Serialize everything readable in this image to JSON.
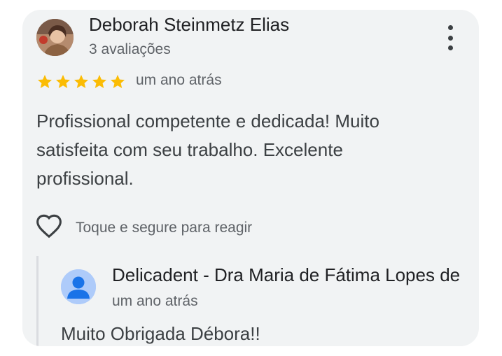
{
  "review": {
    "author_name": "Deborah Steinmetz Elias",
    "review_count": "3 avaliações",
    "rating": 5,
    "rating_max": 5,
    "star_color": "#fbbc04",
    "time": "um ano atrás",
    "text": "Profissional competente e dedicada! Muito satisfeita com seu trabalho. Excelente profissional.",
    "react_label": "Toque e segure para reagir"
  },
  "reply": {
    "owner_name": "Delicadent - Dra Maria de Fátima Lopes de",
    "time": "um ano atrás",
    "text": "Muito Obrigada Débora!!"
  },
  "icons": {
    "menu": "more-vert-icon",
    "react": "heart-outline-icon",
    "owner_avatar": "person-icon"
  }
}
